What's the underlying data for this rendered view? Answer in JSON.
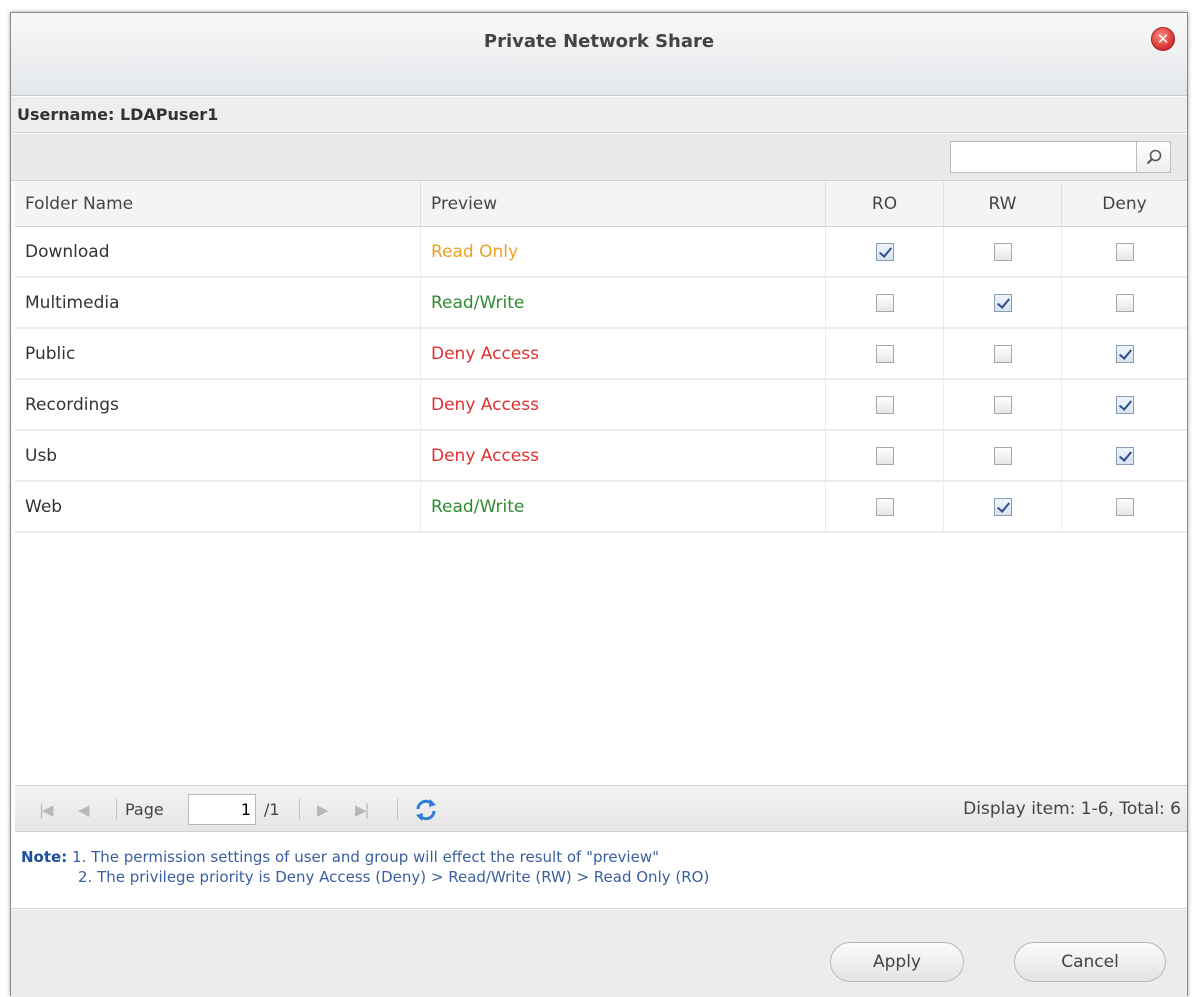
{
  "dialog": {
    "title": "Private Network Share",
    "close_icon": "close-circle-icon"
  },
  "user": {
    "label": "Username: LDAPuser1"
  },
  "search": {
    "value": "",
    "placeholder": "",
    "icon": "search-icon"
  },
  "table": {
    "headers": {
      "folder_name": "Folder Name",
      "preview": "Preview",
      "ro": "RO",
      "rw": "RW",
      "deny": "Deny"
    },
    "rows": [
      {
        "folder": "Download",
        "preview": "Read Only",
        "preview_color": "#f0a020",
        "ro": true,
        "rw": false,
        "deny": false
      },
      {
        "folder": "Multimedia",
        "preview": "Read/Write",
        "preview_color": "#2e8b2e",
        "ro": false,
        "rw": true,
        "deny": false
      },
      {
        "folder": "Public",
        "preview": "Deny Access",
        "preview_color": "#e03030",
        "ro": false,
        "rw": false,
        "deny": true
      },
      {
        "folder": "Recordings",
        "preview": "Deny Access",
        "preview_color": "#e03030",
        "ro": false,
        "rw": false,
        "deny": true
      },
      {
        "folder": "Usb",
        "preview": "Deny Access",
        "preview_color": "#e03030",
        "ro": false,
        "rw": false,
        "deny": true
      },
      {
        "folder": "Web",
        "preview": "Read/Write",
        "preview_color": "#2e8b2e",
        "ro": false,
        "rw": true,
        "deny": false
      }
    ]
  },
  "pager": {
    "page_label": "Page",
    "page_value": "1",
    "page_total": "/1",
    "display_info": "Display item: 1-6, Total: 6"
  },
  "note": {
    "label": "Note:",
    "line1": "1. The permission settings of user and group will effect the result of \"preview\"",
    "line2": "2. The privilege priority is Deny Access (Deny) > Read/Write (RW) > Read Only (RO)"
  },
  "buttons": {
    "apply": "Apply",
    "cancel": "Cancel"
  },
  "colors": {
    "read_only": "#f0a020",
    "read_write": "#2e8b2e",
    "deny": "#e03030",
    "note_text": "#3a5f9e"
  }
}
